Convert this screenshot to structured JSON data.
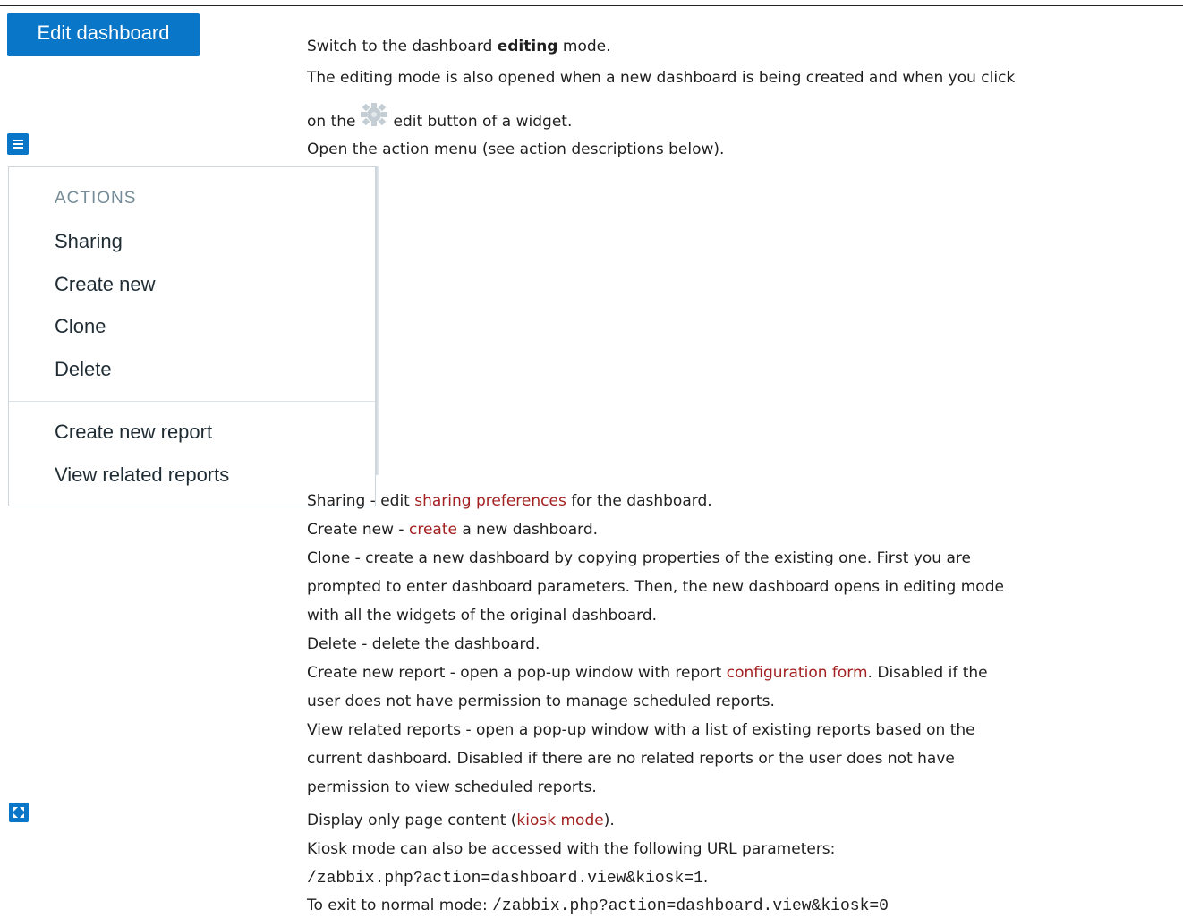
{
  "edit_button": {
    "label": "Edit dashboard"
  },
  "edit_desc": {
    "line1_pre": "Switch to the dashboard ",
    "line1_bold": "editing",
    "line1_post": " mode.",
    "line2": "The editing mode is also opened when a new dashboard is being created and when you click",
    "line3_pre": "on the",
    "line3_post": "edit button of a widget."
  },
  "action_menu_desc": "Open the action menu (see action descriptions below).",
  "menu": {
    "heading": "ACTIONS",
    "items": [
      "Sharing",
      "Create new",
      "Clone",
      "Delete"
    ],
    "report_items": [
      "Create new report",
      "View related reports"
    ]
  },
  "actions": {
    "sharing": {
      "pre": "Sharing - edit ",
      "link": "sharing preferences",
      "post": " for the dashboard."
    },
    "create": {
      "pre": "Create new - ",
      "link": "create",
      "post": " a new dashboard."
    },
    "clone": [
      "Clone - create a new dashboard by copying properties of the existing one. First you are",
      "prompted to enter dashboard parameters. Then, the new dashboard opens in editing mode",
      "with all the widgets of the original dashboard."
    ],
    "delete": "Delete - delete the dashboard.",
    "report": {
      "pre": "Create new report - open a pop-up window with report ",
      "link": "configuration form",
      "post": ". Disabled if the",
      "line2": "user does not have permission to manage scheduled reports."
    },
    "view_reports": [
      "View related reports - open a pop-up window with a list of existing reports based on the",
      "current dashboard. Disabled if there are no related reports or the user does not have",
      "permission to view scheduled reports."
    ]
  },
  "kiosk": {
    "pre": "Display only page content (",
    "link": "kiosk mode",
    "post": ").",
    "line2": "Kiosk mode can also be accessed with the following URL parameters:",
    "url_on": "/zabbix.php?action=dashboard.view&kiosk=1",
    "url_on_suffix": ".",
    "exit_label": "To exit to normal mode: ",
    "url_off": "/zabbix.php?action=dashboard.view&kiosk=0"
  },
  "colors": {
    "accent": "#0a76c8",
    "link": "#a32020",
    "menu_heading": "#768d99"
  }
}
